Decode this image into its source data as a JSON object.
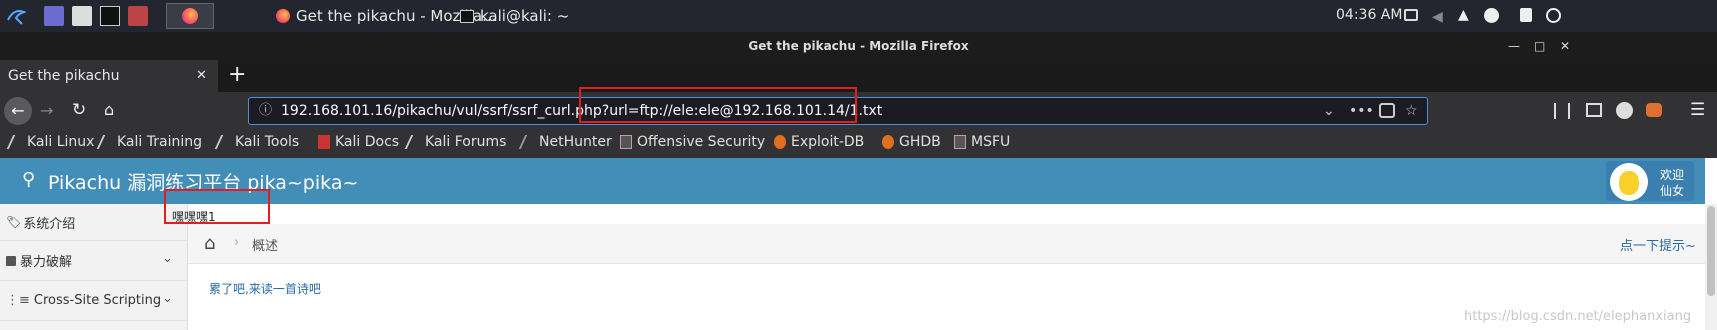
{
  "taskbar": {
    "tasks": [
      {
        "label": "Get the pikachu - Mozilla..."
      },
      {
        "label": "kali@kali: ~"
      }
    ],
    "clock": "04:36 AM"
  },
  "window": {
    "title": "Get the pikachu - Mozilla Firefox"
  },
  "tab": {
    "title": "Get the pikachu",
    "close": "✕",
    "new": "+"
  },
  "urlbar": {
    "url": "192.168.101.16/pikachu/vul/ssrf/ssrf_curl.php?url=ftp://ele:ele@192.168.101.14/1.txt",
    "url_host_path": "192.168.101.16/pikachu/vul/ssrf/ssrf_curl.php",
    "url_query": "?url=ftp://ele:ele@192.168.101.14/1.txt",
    "more": "•••"
  },
  "bookmarks": [
    {
      "label": "Kali Linux"
    },
    {
      "label": "Kali Training"
    },
    {
      "label": "Kali Tools"
    },
    {
      "label": "Kali Docs"
    },
    {
      "label": "Kali Forums"
    },
    {
      "label": "NetHunter"
    },
    {
      "label": "Offensive Security"
    },
    {
      "label": "Exploit-DB"
    },
    {
      "label": "GHDB"
    },
    {
      "label": "MSFU"
    }
  ],
  "site": {
    "title": "Pikachu 漏洞练习平台 pika~pika~",
    "user_greeting": "欢迎",
    "user_name": "仙女",
    "output_text": "嘿嘿嘿1",
    "sidebar": [
      {
        "label": "系统介绍",
        "icon": "tag-icon"
      },
      {
        "label": "暴力破解",
        "icon": "lock-icon"
      },
      {
        "label": "Cross-Site Scripting",
        "icon": "list-icon"
      }
    ],
    "breadcrumb": {
      "current": "概述",
      "sep": "›"
    },
    "hint_link": "点一下提示~",
    "poem_link": "累了吧,来读一首诗吧"
  },
  "watermark": "https://blog.csdn.net/elephanxiang",
  "colors": {
    "header": "#438eb9",
    "highlight": "#e02020",
    "link": "#2a6aa8"
  }
}
